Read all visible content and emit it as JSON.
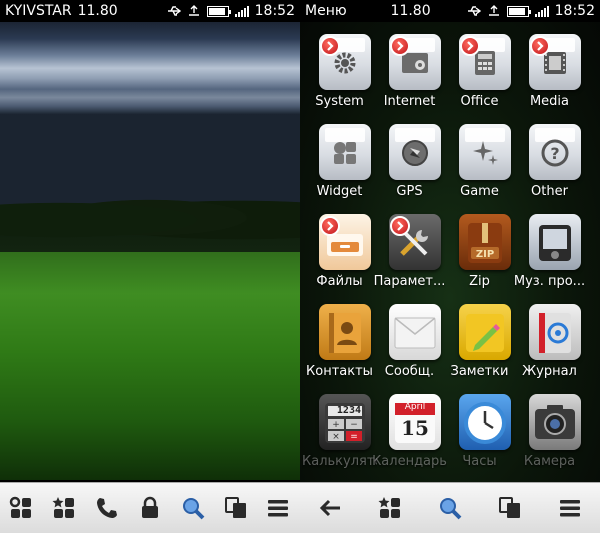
{
  "left": {
    "status": {
      "operator": "KYIVSTAR",
      "network": "11.80",
      "time": "18:52"
    },
    "dock": [
      {
        "name": "apps-grid-icon"
      },
      {
        "name": "favorites-icon"
      },
      {
        "name": "phone-icon"
      },
      {
        "name": "lock-icon"
      },
      {
        "name": "search-icon"
      },
      {
        "name": "switcher-icon"
      },
      {
        "name": "menu-icon"
      }
    ]
  },
  "right": {
    "status": {
      "title": "Меню",
      "network": "11.80",
      "time": "18:52"
    },
    "apps": [
      {
        "label": "System",
        "icon": "gear-icon",
        "badge": true,
        "style": "folder"
      },
      {
        "label": "Internet",
        "icon": "browser-icon",
        "badge": true,
        "style": "folder"
      },
      {
        "label": "Office",
        "icon": "calculator-icon",
        "badge": true,
        "style": "folder"
      },
      {
        "label": "Media",
        "icon": "film-icon",
        "badge": true,
        "style": "folder"
      },
      {
        "label": "Widget",
        "icon": "widget-icon",
        "badge": false,
        "style": "folder"
      },
      {
        "label": "GPS",
        "icon": "compass-icon",
        "badge": false,
        "style": "folder"
      },
      {
        "label": "Game",
        "icon": "sparkle-icon",
        "badge": false,
        "style": "folder"
      },
      {
        "label": "Other",
        "icon": "question-icon",
        "badge": false,
        "style": "folder"
      },
      {
        "label": "Файлы",
        "icon": "file-cabinet-icon",
        "badge": true,
        "style": "files"
      },
      {
        "label": "Парамет...",
        "icon": "tools-icon",
        "badge": true,
        "style": "tools"
      },
      {
        "label": "Zip",
        "icon": "zip-icon",
        "badge": false,
        "style": "zip"
      },
      {
        "label": "Муз. про...",
        "icon": "music-player-icon",
        "badge": false,
        "style": "music"
      },
      {
        "label": "Контакты",
        "icon": "contacts-icon",
        "badge": false,
        "style": "contacts"
      },
      {
        "label": "Сообщ.",
        "icon": "envelope-icon",
        "badge": false,
        "style": "messages"
      },
      {
        "label": "Заметки",
        "icon": "notes-icon",
        "badge": false,
        "style": "notes"
      },
      {
        "label": "Журнал",
        "icon": "log-icon",
        "badge": false,
        "style": "log"
      },
      {
        "label": "Калькулятор",
        "icon": "calculator-app-icon",
        "badge": false,
        "style": "calc",
        "display": "1234",
        "faded": true
      },
      {
        "label": "Календарь",
        "icon": "calendar-icon",
        "badge": false,
        "style": "calendar",
        "month": "April",
        "day": "15",
        "faded": true
      },
      {
        "label": "Часы",
        "icon": "clock-icon",
        "badge": false,
        "style": "clock",
        "faded": true
      },
      {
        "label": "Камера",
        "icon": "camera-icon",
        "badge": false,
        "style": "camera",
        "faded": true
      }
    ],
    "dock": [
      {
        "name": "back-arrow-icon"
      },
      {
        "name": "favorites-icon"
      },
      {
        "name": "search-icon"
      },
      {
        "name": "switcher-icon"
      },
      {
        "name": "menu-icon"
      }
    ]
  },
  "colors": {
    "badge_red": "#c0141a",
    "dock_bg": "#e6e6e6",
    "dock_icon": "#2a2a2a"
  },
  "battery_level": 0.8
}
